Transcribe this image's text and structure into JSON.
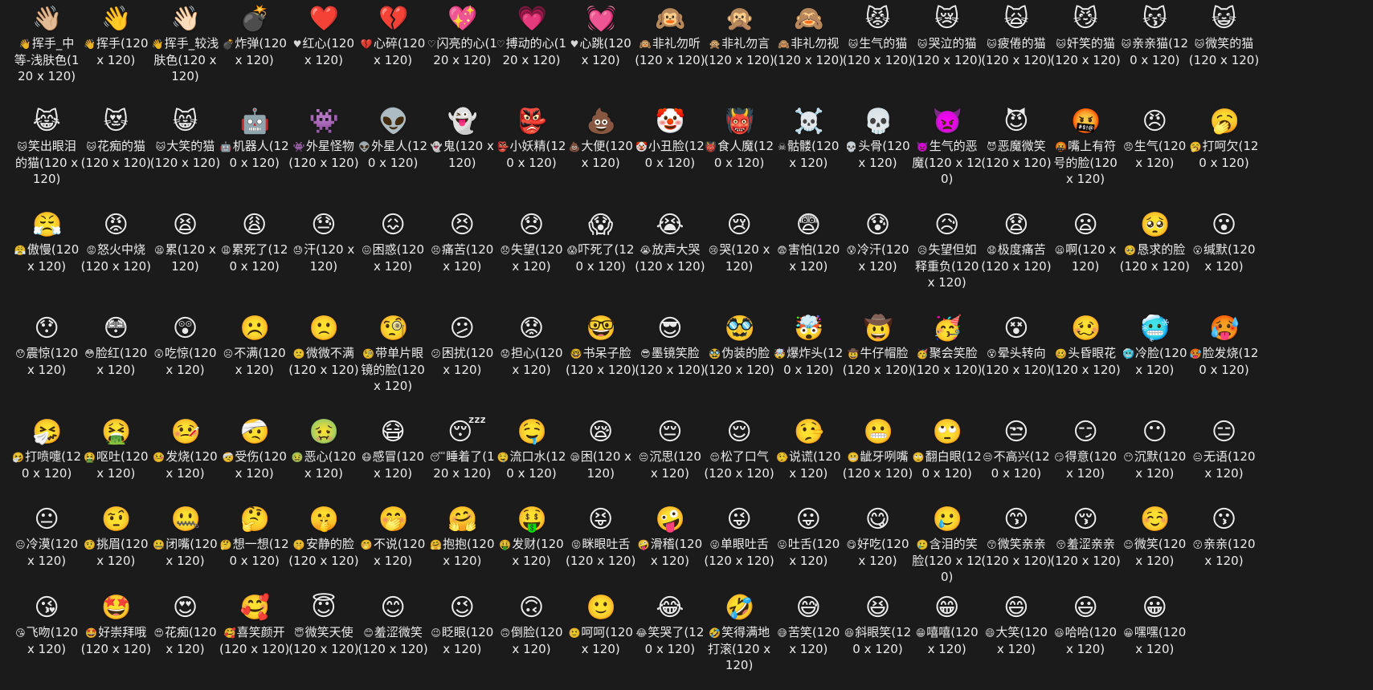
{
  "emoji_grid": {
    "rows": [
      [
        {
          "emoji": "👋🏼",
          "icon": "👋",
          "label": "挥手_中等-浅肤色(120 x 120)"
        },
        {
          "emoji": "👋",
          "icon": "👋",
          "label": "挥手(120 x 120)"
        },
        {
          "emoji": "👋🏻",
          "icon": "👋",
          "label": "挥手_较浅肤色(120 x 120)"
        },
        {
          "emoji": "💣",
          "icon": "💣",
          "label": "炸弹(120 x 120)"
        },
        {
          "emoji": "❤️",
          "icon": "♥",
          "label": "红心(120 x 120)"
        },
        {
          "emoji": "💔",
          "icon": "💔",
          "label": "心碎(120 x 120)"
        },
        {
          "emoji": "💖",
          "icon": "♡",
          "label": "闪亮的心(120 x 120)"
        },
        {
          "emoji": "💗",
          "icon": "♡",
          "label": "搏动的心(120 x 120)"
        },
        {
          "emoji": "💓",
          "icon": "♥",
          "label": "心跳(120 x 120)"
        },
        {
          "emoji": "🙉",
          "icon": "🙉",
          "label": "非礼勿听(120 x 120)"
        },
        {
          "emoji": "🙊",
          "icon": "🙊",
          "label": "非礼勿言(120 x 120)"
        },
        {
          "emoji": "🙈",
          "icon": "🙈",
          "label": "非礼勿视(120 x 120)"
        },
        {
          "emoji": "😾",
          "icon": "🐱",
          "label": "生气的猫(120 x 120)"
        },
        {
          "emoji": "😿",
          "icon": "🐱",
          "label": "哭泣的猫(120 x 120)"
        },
        {
          "emoji": "🙀",
          "icon": "🐱",
          "label": "疲倦的猫(120 x 120)"
        },
        {
          "emoji": "😼",
          "icon": "🐱",
          "label": "奸笑的猫(120 x 120)"
        },
        {
          "emoji": "😽",
          "icon": "🐱",
          "label": "亲亲猫(120 x 120)"
        },
        {
          "emoji": "😺",
          "icon": "🐱",
          "label": "微笑的猫(120 x 120)"
        }
      ],
      [
        {
          "emoji": "😹",
          "icon": "🐱",
          "label": "笑出眼泪的猫(120 x 120)"
        },
        {
          "emoji": "😻",
          "icon": "🐱",
          "label": "花痴的猫(120 x 120)"
        },
        {
          "emoji": "😸",
          "icon": "🐱",
          "label": "大笑的猫(120 x 120)"
        },
        {
          "emoji": "🤖",
          "icon": "🤖",
          "label": "机器人(120 x 120)"
        },
        {
          "emoji": "👾",
          "icon": "👾",
          "label": "外星怪物(120 x 120)"
        },
        {
          "emoji": "👽",
          "icon": "👽",
          "label": "外星人(120 x 120)"
        },
        {
          "emoji": "👻",
          "icon": "👻",
          "label": "鬼(120 x 120)"
        },
        {
          "emoji": "👺",
          "icon": "👺",
          "label": "小妖精(120 x 120)"
        },
        {
          "emoji": "💩",
          "icon": "💩",
          "label": "大便(120 x 120)"
        },
        {
          "emoji": "🤡",
          "icon": "🤡",
          "label": "小丑脸(120 x 120)"
        },
        {
          "emoji": "👹",
          "icon": "👹",
          "label": "食人魔(120 x 120)"
        },
        {
          "emoji": "☠️",
          "icon": "☠",
          "label": "骷髅(120 x 120)"
        },
        {
          "emoji": "💀",
          "icon": "💀",
          "label": "头骨(120 x 120)"
        },
        {
          "emoji": "👿",
          "icon": "👿",
          "label": "生气的恶魔(120 x 120)"
        },
        {
          "emoji": "😈",
          "icon": "😈",
          "label": "恶魔微笑(120 x 120)"
        },
        {
          "emoji": "🤬",
          "icon": "🤬",
          "label": "嘴上有符号的脸(120 x 120)"
        },
        {
          "emoji": "😠",
          "icon": "😠",
          "label": "生气(120 x 120)"
        },
        {
          "emoji": "🥱",
          "icon": "🥱",
          "label": "打呵欠(120 x 120)"
        }
      ],
      [
        {
          "emoji": "😤",
          "icon": "😤",
          "label": "傲慢(120 x 120)"
        },
        {
          "emoji": "😡",
          "icon": "😡",
          "label": "怒火中烧(120 x 120)"
        },
        {
          "emoji": "😫",
          "icon": "😫",
          "label": "累(120 x 120)"
        },
        {
          "emoji": "😩",
          "icon": "😩",
          "label": "累死了(120 x 120)"
        },
        {
          "emoji": "😓",
          "icon": "😓",
          "label": "汗(120 x 120)"
        },
        {
          "emoji": "😖",
          "icon": "😖",
          "label": "困惑(120 x 120)"
        },
        {
          "emoji": "😣",
          "icon": "😣",
          "label": "痛苦(120 x 120)"
        },
        {
          "emoji": "😞",
          "icon": "😞",
          "label": "失望(120 x 120)"
        },
        {
          "emoji": "😱",
          "icon": "😱",
          "label": "吓死了(120 x 120)"
        },
        {
          "emoji": "😭",
          "icon": "😭",
          "label": "放声大哭(120 x 120)"
        },
        {
          "emoji": "😢",
          "icon": "😢",
          "label": "哭(120 x 120)"
        },
        {
          "emoji": "😨",
          "icon": "😨",
          "label": "害怕(120 x 120)"
        },
        {
          "emoji": "😰",
          "icon": "😰",
          "label": "冷汗(120 x 120)"
        },
        {
          "emoji": "😥",
          "icon": "😥",
          "label": "失望但如释重负(120 x 120)"
        },
        {
          "emoji": "😧",
          "icon": "😧",
          "label": "极度痛苦(120 x 120)"
        },
        {
          "emoji": "😦",
          "icon": "😦",
          "label": "啊(120 x 120)"
        },
        {
          "emoji": "🥺",
          "icon": "🥺",
          "label": "恳求的脸(120 x 120)"
        },
        {
          "emoji": "😮",
          "icon": "😮",
          "label": "缄默(120 x 120)"
        }
      ],
      [
        {
          "emoji": "😯",
          "icon": "😯",
          "label": "震惊(120 x 120)"
        },
        {
          "emoji": "😳",
          "icon": "😳",
          "label": "脸红(120 x 120)"
        },
        {
          "emoji": "😲",
          "icon": "😲",
          "label": "吃惊(120 x 120)"
        },
        {
          "emoji": "☹️",
          "icon": "☹",
          "label": "不满(120 x 120)"
        },
        {
          "emoji": "🙁",
          "icon": "🙁",
          "label": "微微不满(120 x 120)"
        },
        {
          "emoji": "🧐",
          "icon": "🧐",
          "label": "带单片眼镜的脸(120 x 120)"
        },
        {
          "emoji": "😕",
          "icon": "😕",
          "label": "困扰(120 x 120)"
        },
        {
          "emoji": "😟",
          "icon": "😟",
          "label": "担心(120 x 120)"
        },
        {
          "emoji": "🤓",
          "icon": "🤓",
          "label": "书呆子脸(120 x 120)"
        },
        {
          "emoji": "😎",
          "icon": "😎",
          "label": "墨镜笑脸(120 x 120)"
        },
        {
          "emoji": "🥸",
          "icon": "🥸",
          "label": "伪装的脸(120 x 120)"
        },
        {
          "emoji": "🤯",
          "icon": "🤯",
          "label": "爆炸头(120 x 120)"
        },
        {
          "emoji": "🤠",
          "icon": "🤠",
          "label": "牛仔帽脸(120 x 120)"
        },
        {
          "emoji": "🥳",
          "icon": "🥳",
          "label": "聚会笑脸(120 x 120)"
        },
        {
          "emoji": "😵",
          "icon": "😵",
          "label": "晕头转向(120 x 120)"
        },
        {
          "emoji": "🥴",
          "icon": "🥴",
          "label": "头昏眼花(120 x 120)"
        },
        {
          "emoji": "🥶",
          "icon": "🥶",
          "label": "冷脸(120 x 120)"
        },
        {
          "emoji": "🥵",
          "icon": "🥵",
          "label": "脸发烧(120 x 120)"
        }
      ],
      [
        {
          "emoji": "🤧",
          "icon": "🤧",
          "label": "打喷嚏(120 x 120)"
        },
        {
          "emoji": "🤮",
          "icon": "🤮",
          "label": "呕吐(120 x 120)"
        },
        {
          "emoji": "🤒",
          "icon": "🤒",
          "label": "发烧(120 x 120)"
        },
        {
          "emoji": "🤕",
          "icon": "🤕",
          "label": "受伤(120 x 120)"
        },
        {
          "emoji": "🤢",
          "icon": "🤢",
          "label": "恶心(120 x 120)"
        },
        {
          "emoji": "😷",
          "icon": "😷",
          "label": "感冒(120 x 120)"
        },
        {
          "emoji": "😴",
          "icon": "😴",
          "label": "睡着了(120 x 120)"
        },
        {
          "emoji": "🤤",
          "icon": "🤤",
          "label": "流口水(120 x 120)"
        },
        {
          "emoji": "😪",
          "icon": "😪",
          "label": "困(120 x 120)"
        },
        {
          "emoji": "😔",
          "icon": "😔",
          "label": "沉思(120 x 120)"
        },
        {
          "emoji": "😌",
          "icon": "😌",
          "label": "松了口气(120 x 120)"
        },
        {
          "emoji": "🤥",
          "icon": "🤥",
          "label": "说谎(120 x 120)"
        },
        {
          "emoji": "😬",
          "icon": "😬",
          "label": "龇牙咧嘴(120 x 120)"
        },
        {
          "emoji": "🙄",
          "icon": "🙄",
          "label": "翻白眼(120 x 120)"
        },
        {
          "emoji": "😒",
          "icon": "😒",
          "label": "不高兴(120 x 120)"
        },
        {
          "emoji": "😏",
          "icon": "😏",
          "label": "得意(120 x 120)"
        },
        {
          "emoji": "😶",
          "icon": "😶",
          "label": "沉默(120 x 120)"
        },
        {
          "emoji": "😑",
          "icon": "😑",
          "label": "无语(120 x 120)"
        }
      ],
      [
        {
          "emoji": "😐",
          "icon": "😐",
          "label": "冷漠(120 x 120)"
        },
        {
          "emoji": "🤨",
          "icon": "🤨",
          "label": "挑眉(120 x 120)"
        },
        {
          "emoji": "🤐",
          "icon": "🤐",
          "label": "闭嘴(120 x 120)"
        },
        {
          "emoji": "🤔",
          "icon": "🤔",
          "label": "想一想(120 x 120)"
        },
        {
          "emoji": "🤫",
          "icon": "🤫",
          "label": "安静的脸(120 x 120)"
        },
        {
          "emoji": "🤭",
          "icon": "🤭",
          "label": "不说(120 x 120)"
        },
        {
          "emoji": "🤗",
          "icon": "🤗",
          "label": "抱抱(120 x 120)"
        },
        {
          "emoji": "🤑",
          "icon": "🤑",
          "label": "发财(120 x 120)"
        },
        {
          "emoji": "😝",
          "icon": "😝",
          "label": "眯眼吐舌(120 x 120)"
        },
        {
          "emoji": "🤪",
          "icon": "🤪",
          "label": "滑稽(120 x 120)"
        },
        {
          "emoji": "😜",
          "icon": "😜",
          "label": "单眼吐舌(120 x 120)"
        },
        {
          "emoji": "😛",
          "icon": "😛",
          "label": "吐舌(120 x 120)"
        },
        {
          "emoji": "😋",
          "icon": "😋",
          "label": "好吃(120 x 120)"
        },
        {
          "emoji": "🥲",
          "icon": "🥲",
          "label": "含泪的笑脸(120 x 120)"
        },
        {
          "emoji": "😙",
          "icon": "😙",
          "label": "微笑亲亲(120 x 120)"
        },
        {
          "emoji": "😚",
          "icon": "😚",
          "label": "羞涩亲亲(120 x 120)"
        },
        {
          "emoji": "☺️",
          "icon": "☺",
          "label": "微笑(120 x 120)"
        },
        {
          "emoji": "😗",
          "icon": "😗",
          "label": "亲亲(120 x 120)"
        }
      ],
      [
        {
          "emoji": "😘",
          "icon": "😘",
          "label": "飞吻(120 x 120)"
        },
        {
          "emoji": "🤩",
          "icon": "🤩",
          "label": "好崇拜哦(120 x 120)"
        },
        {
          "emoji": "😍",
          "icon": "😍",
          "label": "花痴(120 x 120)"
        },
        {
          "emoji": "🥰",
          "icon": "🥰",
          "label": "喜笑颜开(120 x 120)"
        },
        {
          "emoji": "😇",
          "icon": "😇",
          "label": "微笑天使(120 x 120)"
        },
        {
          "emoji": "😊",
          "icon": "😊",
          "label": "羞涩微笑(120 x 120)"
        },
        {
          "emoji": "😉",
          "icon": "😉",
          "label": "眨眼(120 x 120)"
        },
        {
          "emoji": "🙃",
          "icon": "🙃",
          "label": "倒脸(120 x 120)"
        },
        {
          "emoji": "🙂",
          "icon": "🙂",
          "label": "呵呵(120 x 120)"
        },
        {
          "emoji": "😂",
          "icon": "😂",
          "label": "笑哭了(120 x 120)"
        },
        {
          "emoji": "🤣",
          "icon": "🤣",
          "label": "笑得满地打滚(120 x 120)"
        },
        {
          "emoji": "😅",
          "icon": "😅",
          "label": "苦笑(120 x 120)"
        },
        {
          "emoji": "😆",
          "icon": "😆",
          "label": "斜眼笑(120 x 120)"
        },
        {
          "emoji": "😁",
          "icon": "😁",
          "label": "嘻嘻(120 x 120)"
        },
        {
          "emoji": "😄",
          "icon": "😄",
          "label": "大笑(120 x 120)"
        },
        {
          "emoji": "😃",
          "icon": "😃",
          "label": "哈哈(120 x 120)"
        },
        {
          "emoji": "😀",
          "icon": "😀",
          "label": "嘿嘿(120 x 120)"
        }
      ]
    ]
  }
}
